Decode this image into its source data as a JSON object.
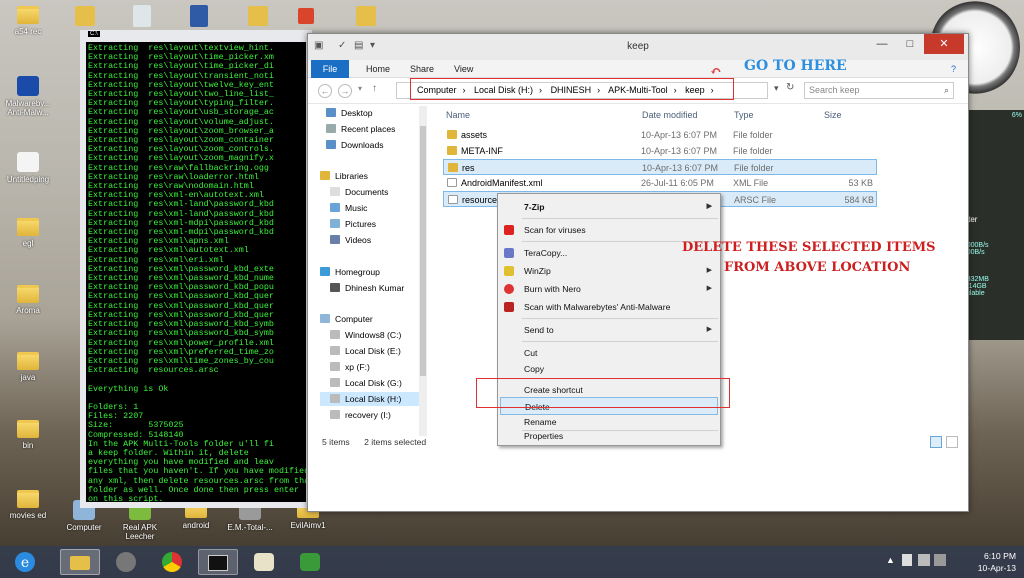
{
  "desktop": {
    "icons": [
      {
        "label": "a54 rec"
      },
      {
        "label": "Malwareby... Anti-Malw..."
      },
      {
        "label": "Untitledping"
      },
      {
        "label": "egl"
      },
      {
        "label": "Aroma"
      },
      {
        "label": "java"
      },
      {
        "label": "bin"
      },
      {
        "label": "movies ed"
      },
      {
        "label": "Computer"
      },
      {
        "label": "Real APK Leecher"
      },
      {
        "label": "android"
      },
      {
        "label": "E.M.-Total-..."
      },
      {
        "label": "EvilAimv1"
      }
    ]
  },
  "console": {
    "title_icon": "C:\\",
    "lines": [
      "Extracting  res\\layout\\textview_hint.",
      "Extracting  res\\layout\\time_picker.xm",
      "Extracting  res\\layout\\time_picker_di",
      "Extracting  res\\layout\\transient_noti",
      "Extracting  res\\layout\\twelve_key_ent",
      "Extracting  res\\layout\\two_line_list_",
      "Extracting  res\\layout\\typing_filter.",
      "Extracting  res\\layout\\usb_storage_ac",
      "Extracting  res\\layout\\volume_adjust.",
      "Extracting  res\\layout\\zoom_browser_a",
      "Extracting  res\\layout\\zoom_container",
      "Extracting  res\\layout\\zoom_controls.",
      "Extracting  res\\layout\\zoom_magnify.x",
      "Extracting  res\\raw\\fallbackring.ogg",
      "Extracting  res\\raw\\loaderror.html",
      "Extracting  res\\raw\\nodomain.html",
      "Extracting  res\\xml-en\\autotext.xml",
      "Extracting  res\\xml-land\\password_kbd",
      "Extracting  res\\xml-land\\password_kbd",
      "Extracting  res\\xml-mdpi\\password_kbd",
      "Extracting  res\\xml-mdpi\\password_kbd",
      "Extracting  res\\xml\\apns.xml",
      "Extracting  res\\xml\\autotext.xml",
      "Extracting  res\\xml\\eri.xml",
      "Extracting  res\\xml\\password_kbd_exte",
      "Extracting  res\\xml\\password_kbd_nume",
      "Extracting  res\\xml\\password_kbd_popu",
      "Extracting  res\\xml\\password_kbd_quer",
      "Extracting  res\\xml\\password_kbd_quer",
      "Extracting  res\\xml\\password_kbd_quer",
      "Extracting  res\\xml\\password_kbd_symb",
      "Extracting  res\\xml\\password_kbd_symb",
      "Extracting  res\\xml\\power_profile.xml",
      "Extracting  res\\xml\\preferred_time_zo",
      "Extracting  res\\xml\\time_zones_by_cou",
      "Extracting  resources.arsc",
      "",
      "Everything is Ok",
      "",
      "Folders: 1",
      "Files: 2207",
      "Size:       5375025",
      "Compressed: 5148140",
      "In the APK Multi-Tools folder u'll fi",
      "a keep folder. Within it, delete",
      "everything you have modified and leav",
      "files that you haven't. If you have modified",
      "any xml, then delete resources.arsc from that",
      "folder as well. Once done then press enter",
      "on this script.",
      "Press any key to continue . . ."
    ]
  },
  "explorer": {
    "title": "keep",
    "tabs": [
      "File",
      "Home",
      "Share",
      "View"
    ],
    "breadcrumb": [
      "Computer",
      "Local Disk (H:)",
      "DHINESH",
      "APK-Multi-Tool",
      "keep"
    ],
    "search_placeholder": "Search keep",
    "nav": {
      "favorites": [
        "Desktop",
        "Recent places",
        "Downloads"
      ],
      "libraries_label": "Libraries",
      "libraries": [
        "Documents",
        "Music",
        "Pictures",
        "Videos"
      ],
      "homegroup_label": "Homegroup",
      "homegroup": [
        "Dhinesh Kumar"
      ],
      "computer_label": "Computer",
      "computer": [
        "Windows8 (C:)",
        "Local Disk (E:)",
        "xp (F:)",
        "Local Disk (G:)",
        "Local Disk (H:)",
        "recovery (I:)"
      ]
    },
    "columns": {
      "name": "Name",
      "date": "Date modified",
      "type": "Type",
      "size": "Size"
    },
    "files": [
      {
        "name": "assets",
        "date": "10-Apr-13 6:07 PM",
        "type": "File folder",
        "size": ""
      },
      {
        "name": "META-INF",
        "date": "10-Apr-13 6:07 PM",
        "type": "File folder",
        "size": ""
      },
      {
        "name": "res",
        "date": "10-Apr-13 6:07 PM",
        "type": "File folder",
        "size": ""
      },
      {
        "name": "AndroidManifest.xml",
        "date": "26-Jul-11 6:05 PM",
        "type": "XML File",
        "size": "53 KB"
      },
      {
        "name": "resources",
        "date": "",
        "type": "ARSC File",
        "size": "584 KB"
      }
    ],
    "status": {
      "count": "5 items",
      "selected": "2 items selected"
    }
  },
  "context_menu": {
    "items": [
      {
        "label": "7-Zip",
        "submenu": true
      },
      {
        "label": "Scan for viruses"
      },
      {
        "label": "TeraCopy..."
      },
      {
        "label": "WinZip",
        "submenu": true
      },
      {
        "label": "Burn with Nero",
        "submenu": true
      },
      {
        "label": "Scan with Malwarebytes' Anti-Malware"
      },
      {
        "label": "Send to",
        "submenu": true
      },
      {
        "label": "Cut"
      },
      {
        "label": "Copy"
      },
      {
        "label": "Create shortcut"
      },
      {
        "label": "Delete"
      },
      {
        "label": "Rename"
      },
      {
        "label": "Properties"
      }
    ]
  },
  "annotations": {
    "go_here": "GO TO HERE",
    "delete_line1": "DELETE THESE SELECTED ITEMS",
    "delete_line2": "FROM ABOVE LOCATION"
  },
  "gadgets": {
    "meter_label": "Meter",
    "meter_values": [
      "6%",
      "1.0000B/s",
      "0.000B/s",
      "80.832MB",
      "14614GB",
      "available"
    ]
  },
  "taskbar": {
    "time": "6:10 PM",
    "date": "10-Apr-13"
  },
  "colors": {
    "accent": "#1a6fc4",
    "annotation": "#cc1f1f",
    "console_text": "#3cf23c"
  }
}
